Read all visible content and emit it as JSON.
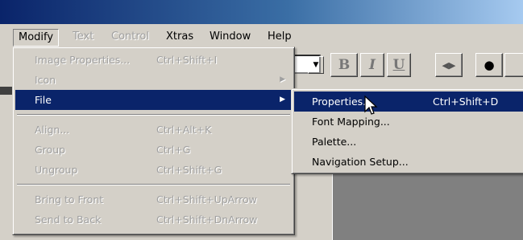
{
  "menubar": {
    "items": [
      {
        "label": "Modify",
        "state": "pressed"
      },
      {
        "label": "Text",
        "state": "disabled"
      },
      {
        "label": "Control",
        "state": "disabled"
      },
      {
        "label": "Xtras",
        "state": "normal"
      },
      {
        "label": "Window",
        "state": "normal"
      },
      {
        "label": "Help",
        "state": "normal"
      }
    ]
  },
  "toolbar": {
    "bold": "B",
    "italic": "I",
    "underline": "U"
  },
  "modify_menu": {
    "items": [
      {
        "label": "Image Properties...",
        "shortcut": "Ctrl+Shift+I"
      },
      {
        "label": "Icon",
        "shortcut": ""
      },
      {
        "label": "File",
        "shortcut": ""
      },
      {
        "label": "Align...",
        "shortcut": "Ctrl+Alt+K"
      },
      {
        "label": "Group",
        "shortcut": "Ctrl+G"
      },
      {
        "label": "Ungroup",
        "shortcut": "Ctrl+Shift+G"
      },
      {
        "label": "Bring to Front",
        "shortcut": "Ctrl+Shift+UpArrow"
      },
      {
        "label": "Send to Back",
        "shortcut": "Ctrl+Shift+DnArrow"
      }
    ]
  },
  "file_submenu": {
    "items": [
      {
        "label": "Properties...",
        "shortcut": "Ctrl+Shift+D"
      },
      {
        "label": "Font Mapping...",
        "shortcut": ""
      },
      {
        "label": "Palette...",
        "shortcut": ""
      },
      {
        "label": "Navigation Setup...",
        "shortcut": ""
      }
    ]
  },
  "colors": {
    "highlight": "#0a246a",
    "face": "#d4d0c8",
    "disabled_text": "#a0a0a0",
    "workspace": "#808080"
  },
  "icons": [
    "submenu-arrow-icon",
    "dropdown-arrow-icon",
    "mouse-pointer-icon",
    "play-button-icon",
    "bomb-icon"
  ]
}
